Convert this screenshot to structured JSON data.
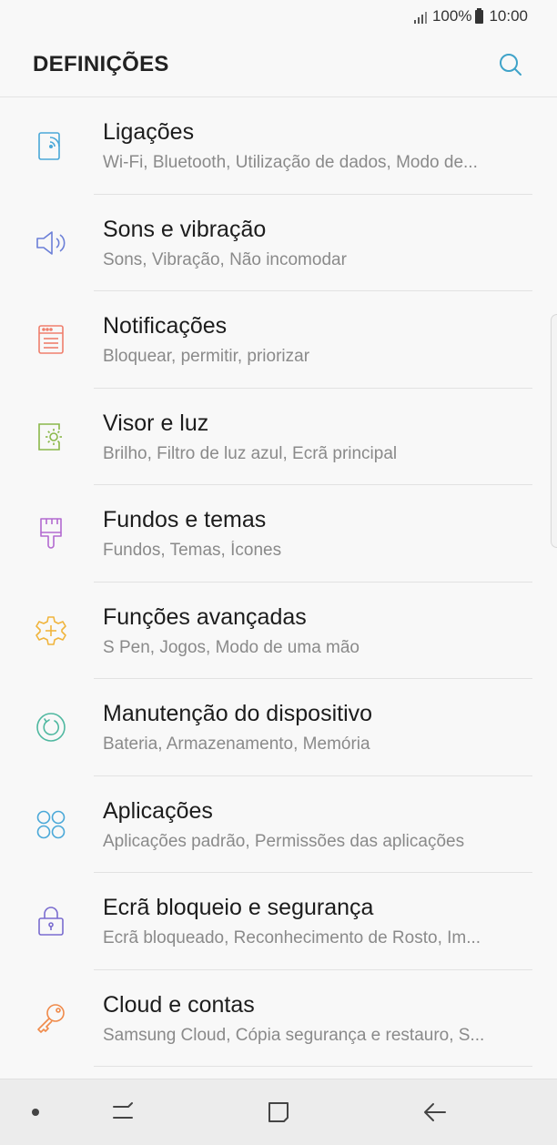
{
  "status_bar": {
    "battery_percent": "100%",
    "time": "10:00"
  },
  "header": {
    "title": "DEFINIÇÕES"
  },
  "settings": [
    {
      "title": "Ligações",
      "subtitle": "Wi-Fi, Bluetooth, Utilização de dados, Modo de...",
      "icon": "connections-icon",
      "color": "#4aa8d8"
    },
    {
      "title": "Sons e vibração",
      "subtitle": "Sons, Vibração, Não incomodar",
      "icon": "speaker-icon",
      "color": "#6b7fd7"
    },
    {
      "title": "Notificações",
      "subtitle": "Bloquear, permitir, priorizar",
      "icon": "notifications-icon",
      "color": "#ef7f6d"
    },
    {
      "title": "Visor e luz",
      "subtitle": "Brilho, Filtro de luz azul, Ecrã principal",
      "icon": "display-icon",
      "color": "#8ab84a"
    },
    {
      "title": "Fundos e temas",
      "subtitle": "Fundos, Temas, Ícones",
      "icon": "paintbrush-icon",
      "color": "#b36ad0"
    },
    {
      "title": "Funções avançadas",
      "subtitle": "S Pen, Jogos, Modo de uma mão",
      "icon": "gear-plus-icon",
      "color": "#f0b43c"
    },
    {
      "title": "Manutenção do dispositivo",
      "subtitle": "Bateria, Armazenamento, Memória",
      "icon": "maintenance-icon",
      "color": "#4fb8a0"
    },
    {
      "title": "Aplicações",
      "subtitle": "Aplicações padrão, Permissões das aplicações",
      "icon": "apps-icon",
      "color": "#4aa8d8"
    },
    {
      "title": "Ecrã bloqueio e segurança",
      "subtitle": "Ecrã bloqueado, Reconhecimento de Rosto, Im...",
      "icon": "lock-icon",
      "color": "#7a6ccf"
    },
    {
      "title": "Cloud e contas",
      "subtitle": "Samsung Cloud, Cópia segurança e restauro, S...",
      "icon": "key-icon",
      "color": "#f08a4a"
    }
  ],
  "colors": {
    "search_accent": "#3fa3c9",
    "background": "#f8f8f8"
  }
}
